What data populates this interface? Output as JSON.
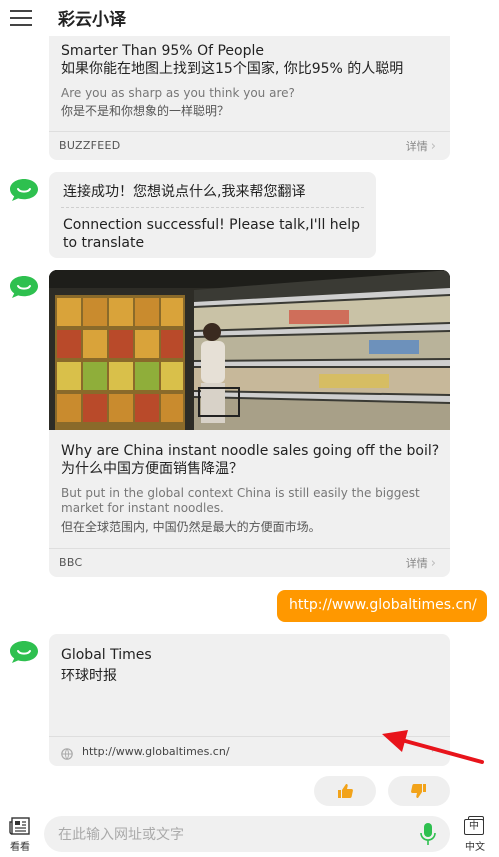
{
  "header": {
    "title": "彩云小译"
  },
  "card1": {
    "en_title": "Smarter Than 95% Of People",
    "zh_title": "如果你能在地图上找到这15个国家, 你比95% 的人聪明",
    "en_sub": "Are you as sharp as you think you are?",
    "zh_sub": "你是不是和你想象的一样聪明？",
    "source": "BUZZFEED",
    "detail": "详情"
  },
  "bot_message": {
    "zh": "连接成功！您想说点什么,我来帮您翻译",
    "en": "Connection successful! Please talk,I'll help to translate"
  },
  "card2": {
    "en_title": "Why are China instant noodle sales going off the boil?",
    "zh_title": "为什么中国方便面销售降温？",
    "en_sub": "But put in the global context China is still easily the biggest market for instant noodles.",
    "zh_sub": "但在全球范围内, 中国仍然是最大的方便面市场。",
    "source": "BBC",
    "detail": "详情"
  },
  "user_message": {
    "text": "http://www.globaltimes.cn/"
  },
  "site_card": {
    "en": "Global Times",
    "zh": "环球时报",
    "url": "http://www.globaltimes.cn/"
  },
  "bottom": {
    "left_label": "看看",
    "placeholder": "在此输入网址或文字",
    "right_label": "中文",
    "right_icon_char": "中"
  },
  "colors": {
    "accent": "#ff9800",
    "bot_green": "#2ec04f",
    "annotation_red": "#e8141b"
  }
}
